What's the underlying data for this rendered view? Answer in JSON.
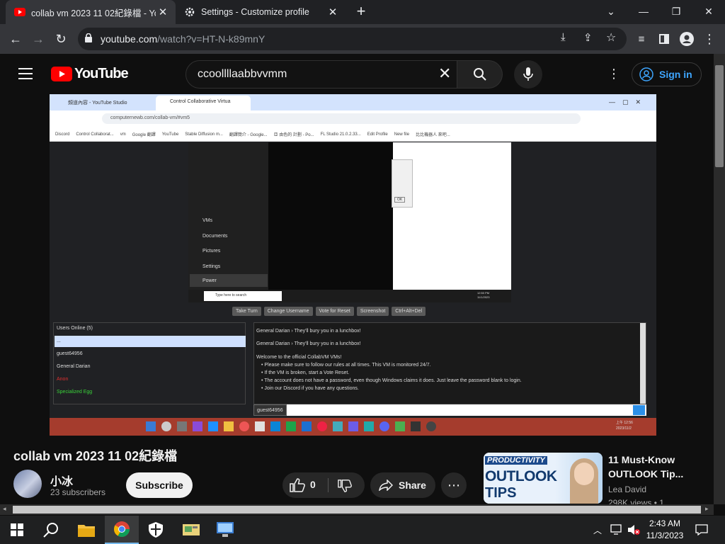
{
  "browser": {
    "tabs": [
      {
        "title": "collab vm 2023 11 02紀錄檔 - YouTube",
        "icon": "youtube-icon",
        "active": true
      },
      {
        "title": "Settings - Customize profile",
        "icon": "gear-icon",
        "active": false
      }
    ],
    "url_host": "youtube.com",
    "url_path": "/watch?v=HT-N-k89mnY"
  },
  "youtube": {
    "logo_text": "YouTube",
    "search_query": "ccoollllaabbvvmm",
    "signin_label": "Sign in"
  },
  "video_frame": {
    "inner_tabs": [
      "頻道內容 - YouTube Studio",
      "Control Collaborative Virtua"
    ],
    "inner_url": "computernewb.com/collab-vm/#vm5",
    "bookmarks": [
      "Discord",
      "Control Collaborat...",
      "vm",
      "Google 翻譯",
      "YouTube",
      "Stable Diffusion m...",
      "翻譯簡介 - Google...",
      "亞 由色的 計劃 - Po...",
      "FL Studio 21.0.2.33...",
      "Edit Profile",
      "New file",
      "比比機器人 來吧..."
    ],
    "start_menu_items": [
      "VMs",
      "Documents",
      "Pictures",
      "Settings",
      "Power"
    ],
    "search_placeholder": "Type here to search",
    "dialog_button": "OK",
    "vm_clock": "12:50 PM\n11/1/2023",
    "toolbar_buttons": [
      "Take Turn",
      "Change Username",
      "Vote for Reset",
      "Screenshot",
      "Ctrl+Alt+Del"
    ],
    "users_header": "Users Online (5)",
    "users": [
      "...",
      "guest64956",
      "General Darian",
      "Anon",
      "Specialized Egg"
    ],
    "chat_lines": [
      "General Darian › They'll bury you in a lunchbox!",
      "General Darian › They'll bury you in a lunchbox!",
      "Welcome to the official CollabVM VMs!",
      "• Please make sure to follow our rules at all times. This VM is monitored 24/7.",
      "• If the VM is broken, start a Vote Reset.",
      "• The account does not have a password, even though Windows claims it does. Just leave the password blank to login.",
      "• Join our Discord if you have any questions."
    ],
    "chat_username": "guest64956",
    "host_clock": "上午 12:56\n2023/11/2"
  },
  "video": {
    "title": "collab vm 2023 11 02紀錄檔",
    "channel": "小冰",
    "subscribers": "23 subscribers",
    "subscribe_label": "Subscribe",
    "likes": "0",
    "share_label": "Share"
  },
  "recommended": {
    "title": "11 Must-Know OUTLOOK Tip...",
    "author": "Lea David",
    "views": "298K views • 1",
    "thumb_text_1": "PRODUCTIVITY",
    "thumb_text_2": "OUTLOOK",
    "thumb_text_3": "TIPS"
  },
  "taskbar": {
    "time": "2:43 AM",
    "date": "11/3/2023"
  },
  "colors": {
    "youtube_red": "#ff0000",
    "link_blue": "#3ea6ff",
    "chrome_dark": "#202124"
  }
}
